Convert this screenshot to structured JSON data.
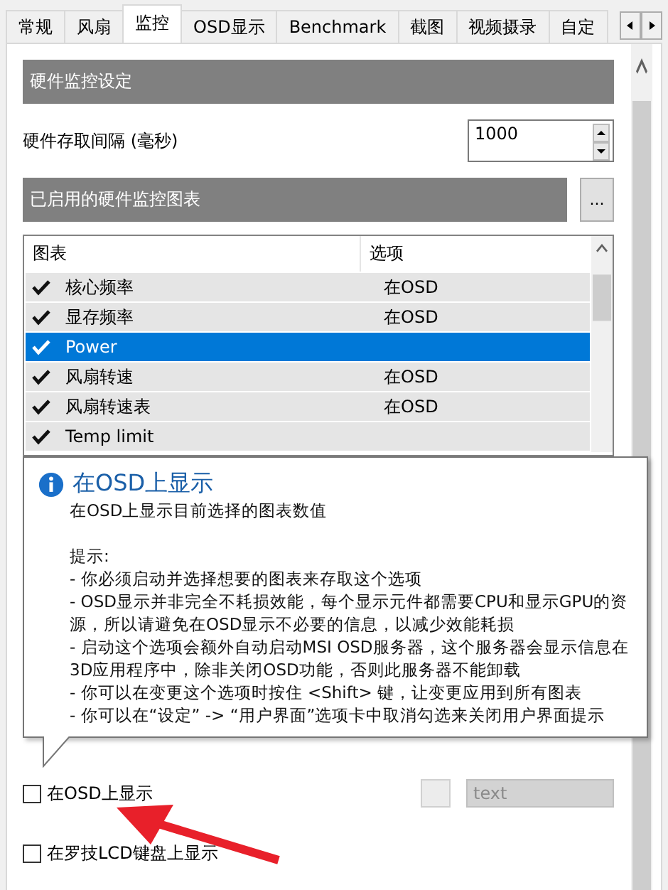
{
  "tabs": [
    {
      "label": "常规",
      "selected": false
    },
    {
      "label": "风扇",
      "selected": false
    },
    {
      "label": "监控",
      "selected": true
    },
    {
      "label": "OSD显示",
      "selected": false
    },
    {
      "label": "Benchmark",
      "selected": false
    },
    {
      "label": "截图",
      "selected": false
    },
    {
      "label": "视频摄录",
      "selected": false
    },
    {
      "label": "自定",
      "selected": false
    }
  ],
  "settings_header": "硬件监控设定",
  "interval": {
    "label": "硬件存取间隔 (毫秒)",
    "value": "1000"
  },
  "charts_header": "已启用的硬件监控图表",
  "more_button": "...",
  "chart_list": {
    "columns": [
      "图表",
      "选项"
    ],
    "rows": [
      {
        "name": "核心频率",
        "option": "在OSD",
        "checked": true,
        "selected": false
      },
      {
        "name": "显存频率",
        "option": "在OSD",
        "checked": true,
        "selected": false
      },
      {
        "name": "Power",
        "checked": true,
        "selected": true
      },
      {
        "name": "风扇转速",
        "option": "在OSD",
        "checked": true,
        "selected": false
      },
      {
        "name": "风扇转速表",
        "option": "在OSD",
        "checked": true,
        "selected": false
      },
      {
        "name": "Temp limit",
        "checked": true,
        "selected": false
      }
    ]
  },
  "tooltip": {
    "title": "在OSD上显示",
    "subtitle": "在OSD上显示目前选择的图表数值",
    "lines": [
      "提示:",
      "- 你必须启动并选择想要的图表来存取这个选项",
      "- OSD显示并非完全不耗损效能，每个显示元件都需要CPU和显示GPU的资源，所以请避免在OSD显示不必要的信息，以减少效能耗损",
      "- 启动这个选项会额外自动启动MSI OSD服务器，这个服务器会显示信息在3D应用程序中，除非关闭OSD功能，否则此服务器不能卸载",
      "- 你可以在变更这个选项时按住 <Shift> 键，让变更应用到所有图表",
      "- 你可以在“设定” -> “用户界面”选项卡中取消勾选来关闭用户界面提示"
    ]
  },
  "options": [
    {
      "label": "在OSD上显示",
      "checked": false
    },
    {
      "label": "在罗技LCD键盘上显示",
      "checked": false
    }
  ],
  "format_dropdown": {
    "value": "text",
    "disabled": true
  }
}
